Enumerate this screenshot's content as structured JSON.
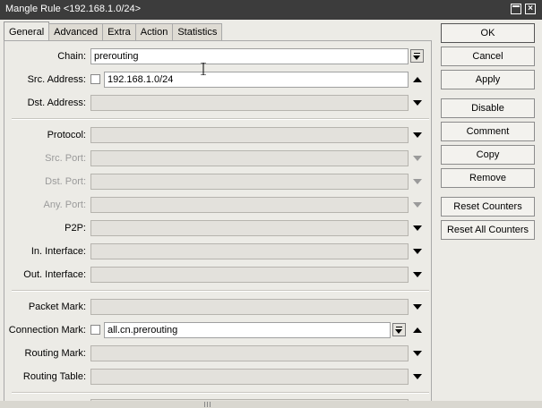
{
  "window": {
    "title": "Mangle Rule <192.168.1.0/24>"
  },
  "tabs": [
    "General",
    "Advanced",
    "Extra",
    "Action",
    "Statistics"
  ],
  "fields": {
    "chain": {
      "label": "Chain:",
      "value": "prerouting"
    },
    "src_address": {
      "label": "Src. Address:",
      "value": "192.168.1.0/24"
    },
    "dst_address": {
      "label": "Dst. Address:",
      "value": ""
    },
    "protocol": {
      "label": "Protocol:",
      "value": ""
    },
    "src_port": {
      "label": "Src. Port:",
      "value": ""
    },
    "dst_port": {
      "label": "Dst. Port:",
      "value": ""
    },
    "any_port": {
      "label": "Any. Port:",
      "value": ""
    },
    "p2p": {
      "label": "P2P:",
      "value": ""
    },
    "in_interface": {
      "label": "In. Interface:",
      "value": ""
    },
    "out_interface": {
      "label": "Out. Interface:",
      "value": ""
    },
    "packet_mark": {
      "label": "Packet Mark:",
      "value": ""
    },
    "connection_mark": {
      "label": "Connection Mark:",
      "value": "all.cn.prerouting"
    },
    "routing_mark": {
      "label": "Routing Mark:",
      "value": ""
    },
    "routing_table": {
      "label": "Routing Table:",
      "value": ""
    }
  },
  "buttons": {
    "ok": "OK",
    "cancel": "Cancel",
    "apply": "Apply",
    "disable": "Disable",
    "comment": "Comment",
    "copy": "Copy",
    "remove": "Remove",
    "reset_counters": "Reset Counters",
    "reset_all_counters": "Reset All Counters"
  }
}
